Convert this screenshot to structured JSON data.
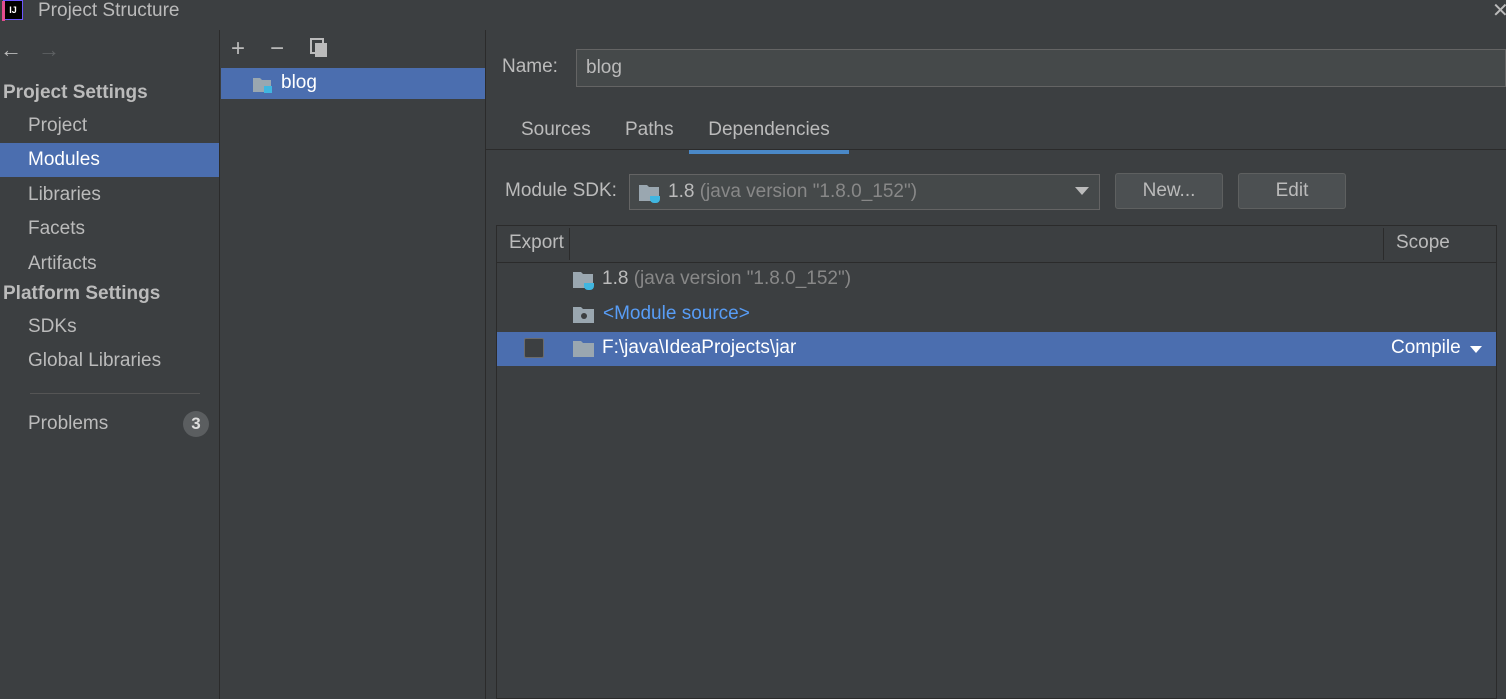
{
  "window": {
    "title": "Project Structure",
    "app_icon_text": "IJ"
  },
  "sidebar": {
    "project_settings_heading": "Project Settings",
    "project_items": [
      "Project",
      "Modules",
      "Libraries",
      "Facets",
      "Artifacts"
    ],
    "selected_item": "Modules",
    "platform_settings_heading": "Platform Settings",
    "platform_items": [
      "SDKs",
      "Global Libraries"
    ],
    "problems_label": "Problems",
    "problems_count": "3"
  },
  "module_list": {
    "toolbar": {
      "add": "+",
      "remove": "−",
      "copy_icon": "copy-icon"
    },
    "modules": [
      "blog"
    ]
  },
  "editor": {
    "name_label": "Name:",
    "name_value": "blog",
    "tabs": [
      "Sources",
      "Paths",
      "Dependencies"
    ],
    "active_tab": "Dependencies",
    "sdk_label": "Module SDK:",
    "sdk_value_main": "1.8",
    "sdk_value_detail": "(java version \"1.8.0_152\")",
    "new_button": "New...",
    "edit_button": "Edit",
    "table": {
      "columns": {
        "export": "Export",
        "scope": "Scope"
      },
      "rows": [
        {
          "main": "1.8",
          "detail": "(java version \"1.8.0_152\")",
          "icon": "jdk-folder-icon",
          "export_checkbox": false,
          "scope": ""
        },
        {
          "main": "<Module source>",
          "detail": "",
          "icon": "module-source-icon",
          "export_checkbox": false,
          "scope": ""
        },
        {
          "main": "F:\\java\\IdeaProjects\\jar",
          "detail": "",
          "icon": "folder-icon",
          "export_checkbox": true,
          "checked": false,
          "scope": "Compile",
          "selected": true
        }
      ]
    }
  },
  "colors": {
    "background": "#3c3f41",
    "selection": "#4b6eaf",
    "link": "#589df6",
    "active_tab_underline": "#4a88c7"
  }
}
